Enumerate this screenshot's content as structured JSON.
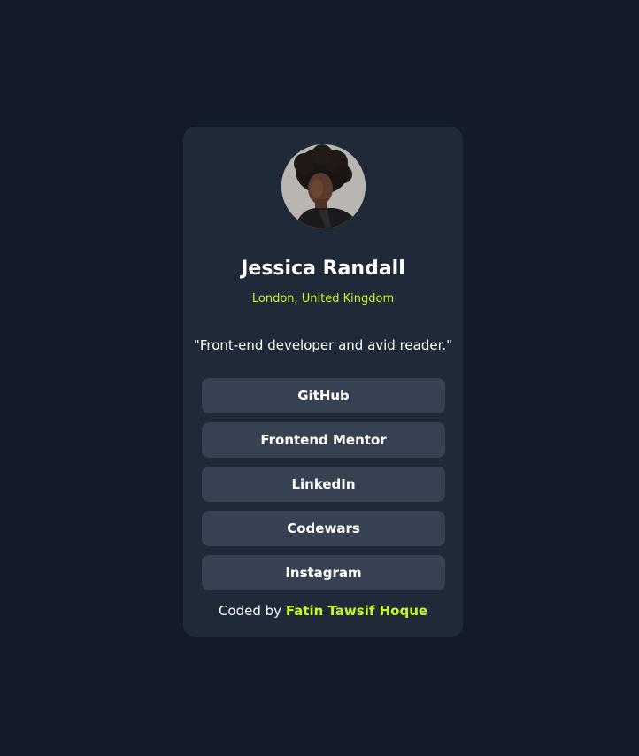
{
  "profile": {
    "name": "Jessica Randall",
    "location": "London, United Kingdom",
    "bio": "\"Front-end developer and avid reader.\""
  },
  "links": [
    {
      "label": "GitHub"
    },
    {
      "label": "Frontend Mentor"
    },
    {
      "label": "LinkedIn"
    },
    {
      "label": "Codewars"
    },
    {
      "label": "Instagram"
    }
  ],
  "footer": {
    "prefix": "Coded by",
    "author": "Fatin Tawsif Hoque"
  },
  "colors": {
    "background": "#141b28",
    "card": "#1f2937",
    "button": "#374151",
    "accent": "#c4f82a",
    "text": "#ffffff"
  }
}
